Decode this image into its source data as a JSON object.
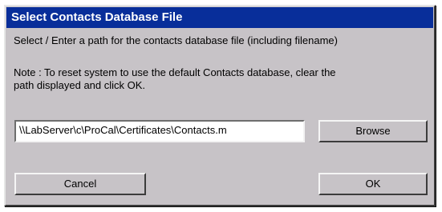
{
  "dialog": {
    "title": "Select Contacts Database File",
    "instruction": "Select / Enter a path for the contacts database file (including filename)",
    "note_line1": "Note : To reset system to use the default Contacts database, clear the",
    "note_line2": "path displayed and click OK."
  },
  "path_field": {
    "value": "\\\\LabServer\\c\\ProCal\\Certificates\\Contacts.m"
  },
  "buttons": {
    "browse": "Browse",
    "cancel": "Cancel",
    "ok": "OK"
  },
  "colors": {
    "title_bar": "#082e9a",
    "dialog_face": "#c7c3c7"
  }
}
